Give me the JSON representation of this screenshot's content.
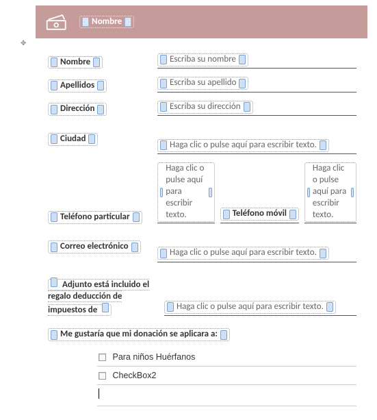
{
  "header": {
    "title_field": "Nombre"
  },
  "labels": {
    "nombre": "Nombre",
    "apellidos": "Apellidos",
    "direccion": "Dirección",
    "ciudad": "Ciudad",
    "telefono_particular": "Teléfono particular",
    "telefono_movil": "Teléfono móvil",
    "correo": "Correo electrónico",
    "adjunto": "Adjunto está incluido el regalo deducción de impuestos de",
    "aplicar": "Me gustaría que mi donación se aplicara a:"
  },
  "placeholders": {
    "nombre": "Escriba su nombre",
    "apellido": "Escriba su apellido",
    "direccion": "Escriba su dirección",
    "generic": "Haga clic o pulse aquí para escribir texto."
  },
  "checkboxes": {
    "cb1": "Para niños Huérfanos",
    "cb2": "CheckBox2"
  }
}
